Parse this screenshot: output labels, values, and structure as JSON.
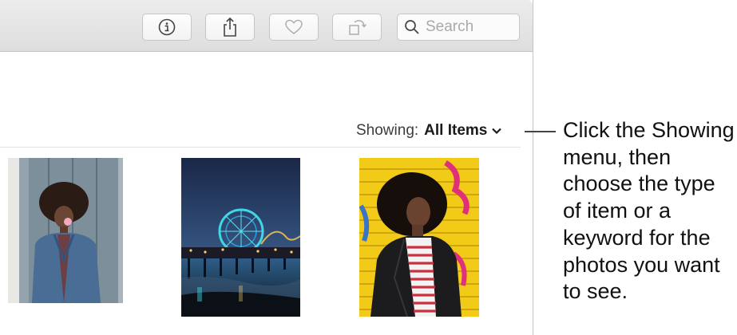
{
  "toolbar": {
    "buttons": [
      {
        "name": "info",
        "icon": "info-icon"
      },
      {
        "name": "share",
        "icon": "share-icon"
      },
      {
        "name": "favorite",
        "icon": "heart-icon",
        "disabled": true
      },
      {
        "name": "rotate",
        "icon": "rotate-icon",
        "disabled": true
      }
    ],
    "search": {
      "placeholder": "Search",
      "icon": "search-icon"
    }
  },
  "showing_menu": {
    "label": "Showing:",
    "value": "All Items",
    "icon": "chevron-down-icon"
  },
  "photos": [
    {
      "name": "photo-woman-bubblegum"
    },
    {
      "name": "photo-ferris-wheel-pier"
    },
    {
      "name": "photo-woman-yellow-wall"
    }
  ],
  "callout": {
    "text": "Click the Showing menu, then choose the type of item or a keyword for the photos you want to see."
  },
  "colors": {
    "toolbar_bg": "#e4e4e4",
    "text": "#111111",
    "divider": "#e3e3e3"
  }
}
